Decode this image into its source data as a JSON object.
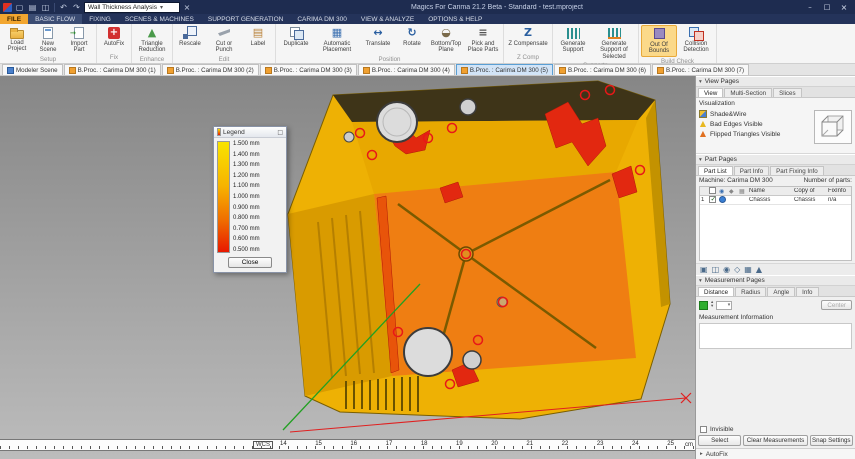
{
  "title_bar": {
    "combo_value": "Wall Thickness Analysis",
    "title": "Magics For Carima 21.2 Beta - Standard - test.mproject"
  },
  "icons": {
    "new": "▢",
    "open": "▤",
    "save": "◫",
    "undo": "↶",
    "redo": "↷",
    "dropdown": "▾",
    "clear": "×",
    "minimize": "–",
    "maximize": "□",
    "close": "×",
    "collapse": "▾",
    "expand": "▸",
    "eye": "◉",
    "diamond": "◆",
    "grid": "▦",
    "spin_up": "▴",
    "spin_down": "▾",
    "window": "□",
    "panel_toolbar": [
      "▣",
      "◫",
      "◉",
      "◇",
      "▦",
      "▲"
    ]
  },
  "menu": {
    "tabs": [
      "FILE",
      "BASIC FLOW",
      "FIXING",
      "SCENES & MACHINES",
      "SUPPORT GENERATION",
      "CARIMA DM 300",
      "VIEW & ANALYZE",
      "OPTIONS & HELP"
    ]
  },
  "ribbon": {
    "groups": [
      {
        "label": "Setup",
        "buttons": [
          {
            "label": "Load Project"
          },
          {
            "label": "New Scene"
          },
          {
            "label": "Import Part"
          }
        ]
      },
      {
        "label": "Fix",
        "buttons": [
          {
            "label": "AutoFix"
          }
        ]
      },
      {
        "label": "Enhance",
        "buttons": [
          {
            "label": "Triangle Reduction"
          }
        ]
      },
      {
        "label": "Edit",
        "buttons": [
          {
            "label": "Rescale"
          },
          {
            "label": "Cut or Punch"
          },
          {
            "label": "Label"
          }
        ]
      },
      {
        "label": "Position",
        "buttons": [
          {
            "label": "Duplicate"
          },
          {
            "label": "Automatic Placement"
          },
          {
            "label": "Translate"
          },
          {
            "label": "Rotate"
          },
          {
            "label": "Bottom/Top Plane"
          },
          {
            "label": "Pick and Place Parts"
          }
        ]
      },
      {
        "label": "Z Comp",
        "buttons": [
          {
            "label": "Z Compensate"
          }
        ]
      },
      {
        "label": "Supports",
        "buttons": [
          {
            "label": "Generate Support"
          },
          {
            "label": "Generate Support of Selected"
          }
        ]
      },
      {
        "label": "Build Check",
        "buttons": [
          {
            "label": "Out Of Bounds"
          },
          {
            "label": "Collision Detection"
          }
        ]
      }
    ]
  },
  "scene_tabs": [
    "Modeler Scene",
    "B.Proc. : Carima DM 300 (1)",
    "B.Proc. : Carima DM 300 (2)",
    "B.Proc. : Carima DM 300 (3)",
    "B.Proc. : Carima DM 300 (4)",
    "B.Proc. : Carima DM 300 (5)",
    "B.Proc. : Carima DM 300 (6)",
    "B.Proc. : Carima DM 300 (7)"
  ],
  "legend": {
    "title": "Legend",
    "values": [
      "1.500 mm",
      "1.400 mm",
      "1.300 mm",
      "1.200 mm",
      "1.100 mm",
      "1.000 mm",
      "0.900 mm",
      "0.800 mm",
      "0.700 mm",
      "0.600 mm",
      "0.500 mm"
    ],
    "close_label": "Close"
  },
  "view_pages": {
    "header": "View Pages",
    "tabs": [
      "View",
      "Multi-Section",
      "Slices"
    ],
    "section_label": "Visualization",
    "options": [
      "Shade&Wire",
      "Bad Edges Visible",
      "Flipped Triangles Visible"
    ]
  },
  "part_pages": {
    "header": "Part Pages",
    "tabs": [
      "Part List",
      "Part Info",
      "Part Fixing Info"
    ],
    "machine_label": "Machine: Carima DM 300",
    "parts_label": "Number of parts:",
    "columns": {
      "name": "Name",
      "copy_of": "Copy of",
      "fixinfo": "FixInfo"
    },
    "row": {
      "index": "1",
      "name": "Chassis",
      "copy_of": "Chassis",
      "fixinfo": "n/a"
    }
  },
  "measurement_pages": {
    "header": "Measurement Pages",
    "tabs": [
      "Distance",
      "Radius",
      "Angle",
      "Info"
    ],
    "center_label": "Center",
    "info_label": "Measurement Information",
    "invisible_label": "Invisible",
    "buttons": [
      "Select",
      "Clear Measurements",
      "Snap Settings"
    ]
  },
  "footer": {
    "autofix_label": "AutoFix"
  },
  "viewport": {
    "ruler_numbers": [
      "14",
      "15",
      "16",
      "17",
      "18",
      "19",
      "20",
      "21",
      "22",
      "23",
      "24",
      "25"
    ],
    "ruler_unit": "cm",
    "wcs_label": "WCS"
  }
}
